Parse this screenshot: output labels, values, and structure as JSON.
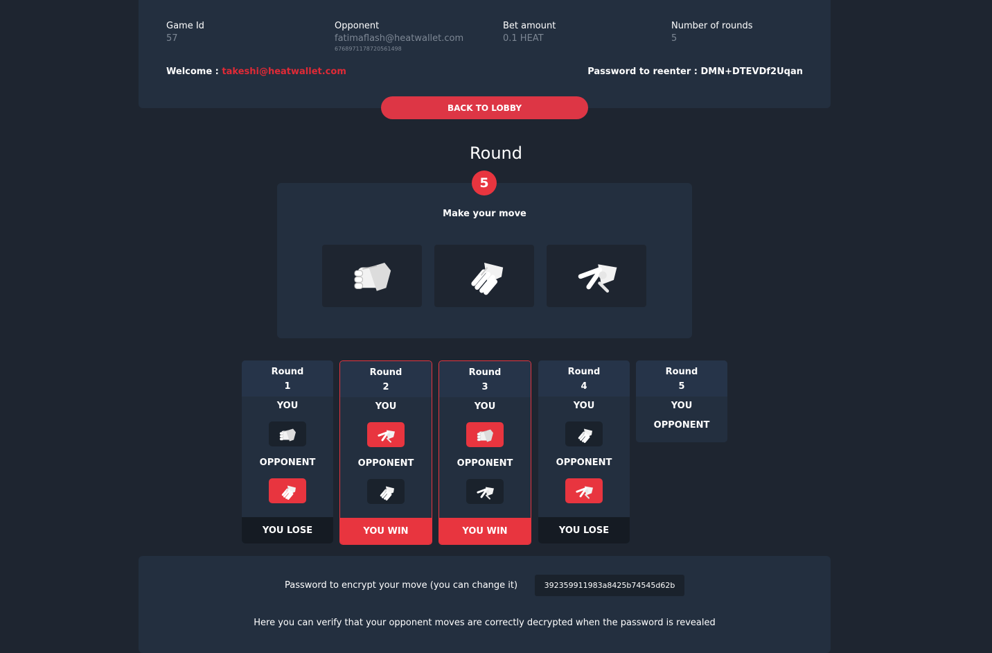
{
  "game_info": {
    "game_id_label": "Game Id",
    "game_id": "57",
    "opponent_label": "Opponent",
    "opponent": "fatimaflash@heatwallet.com",
    "opponent_account": "6768971178720561498",
    "bet_label": "Bet amount",
    "bet": "0.1 HEAT",
    "rounds_label": "Number of rounds",
    "rounds": "5",
    "welcome_label": "Welcome :",
    "welcome_user": "takeshi@heatwallet.com",
    "reenter_password": "Password to reenter : DMN+DTEVDf2Uqan"
  },
  "back_button": "BACK TO LOBBY",
  "current_round": {
    "title": "Round",
    "number": "5",
    "prompt": "Make your move",
    "moves": [
      "rock",
      "paper",
      "scissors"
    ]
  },
  "labels": {
    "round": "Round",
    "you": "YOU",
    "opponent": "OPPONENT"
  },
  "rounds": [
    {
      "number": "1",
      "you_move": "rock",
      "you_highlight": false,
      "opponent_move": "paper",
      "opponent_highlight": true,
      "result": "YOU LOSE",
      "won": false
    },
    {
      "number": "2",
      "you_move": "scissors",
      "you_highlight": true,
      "opponent_move": "paper",
      "opponent_highlight": false,
      "result": "YOU WIN",
      "won": true
    },
    {
      "number": "3",
      "you_move": "rock",
      "you_highlight": true,
      "opponent_move": "scissors",
      "opponent_highlight": false,
      "result": "YOU WIN",
      "won": true
    },
    {
      "number": "4",
      "you_move": "paper",
      "you_highlight": false,
      "opponent_move": "scissors",
      "opponent_highlight": true,
      "result": "YOU LOSE",
      "won": false
    },
    {
      "number": "5",
      "you_move": null,
      "opponent_move": null,
      "result": null,
      "won": false
    }
  ],
  "encrypt": {
    "label": "Password to encrypt your move (you can change it)",
    "value": "392359911983a8425b74545d62b"
  },
  "verify_text": "Here you can verify that your opponent moves are correctly decrypted when the password is revealed",
  "colors": {
    "background": "#1e2530",
    "panel": "#232f3f",
    "accent": "#e8353f",
    "button": "#dd3645"
  }
}
